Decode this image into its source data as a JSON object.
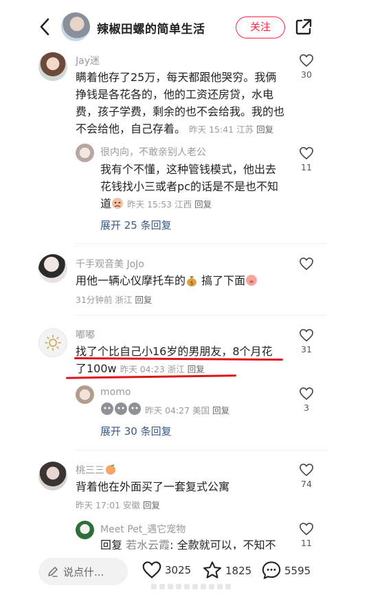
{
  "header": {
    "author_name": "辣椒田螺的简单生活",
    "follow_label": "关注"
  },
  "comments": [
    {
      "username": "Jay迷",
      "lines": [
        "瞒着他存了25万，每天都跟他哭穷。我俩",
        "挣钱是各花各的，他的工资还房贷，水电",
        "费，孩子学费，剩余的也不会给我。我的也",
        "不会给他，自己存着。"
      ],
      "time": "昨天 15:41",
      "location": "江苏",
      "reply_label": "回复",
      "likes": "30",
      "reply": {
        "username": "很内向，不敢亲别人老公",
        "lines": [
          "我有个不懂，这种管钱模式，他出去",
          "花钱找小三或者pc的话是不是也不知",
          "道"
        ],
        "time": "昨天 15:53",
        "location": "江西",
        "reply_label": "回复",
        "likes": "11"
      },
      "expand_label": "展开 25 条回复"
    },
    {
      "username": "千手观音美 JoJo",
      "text_a": "用他一辆心仪摩托车的",
      "text_b": "搞了下面",
      "time": "31分钟前",
      "location": "浙江",
      "reply_label": "回复",
      "likes": ""
    },
    {
      "username": "嘟嘟",
      "line1": "找了个比自己小16岁的男朋友，8个月花",
      "line2": "了100w",
      "time": "昨天 04:23",
      "location": "浙江",
      "reply_label": "回复",
      "likes": "31",
      "reply": {
        "username": "momo",
        "time": "昨天 04:27",
        "location": "美国",
        "reply_label": "回复",
        "likes": "3"
      },
      "expand_label": "展开 30 条回复"
    },
    {
      "username": "桃三三",
      "text": "背着他在外面买了一套复式公寓",
      "time": "昨天 17:01",
      "location": "安徽",
      "reply_label": "回复",
      "likes": "74",
      "reply": {
        "username": "Meet Pet_遇它宠物",
        "prefix": "回复",
        "target": "若水云霞",
        "text": ": 全款就可以，不知不",
        "likes": "11"
      }
    }
  ],
  "bottom": {
    "placeholder": "说点什...",
    "likes": "3025",
    "stars": "1825",
    "comments": "5595"
  },
  "colors": {
    "accent": "#ff2442",
    "link": "#3a5a86",
    "underline": "#e1141c"
  }
}
